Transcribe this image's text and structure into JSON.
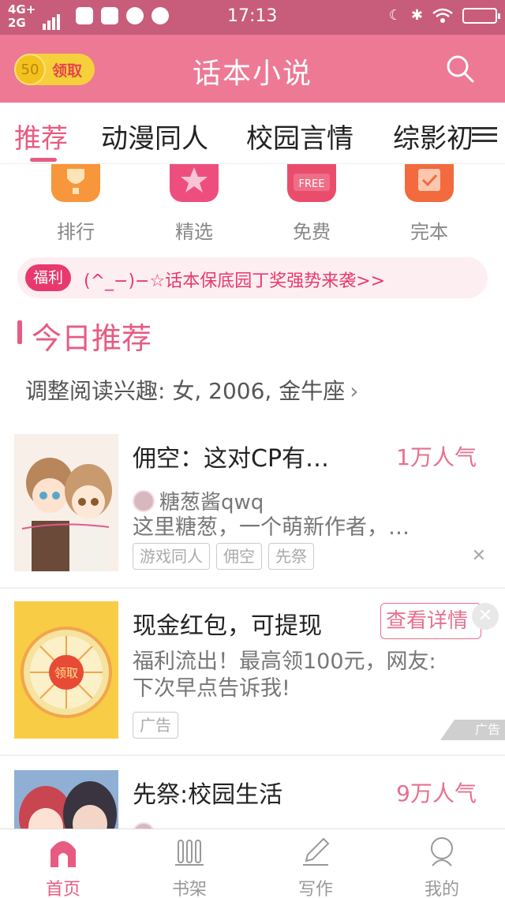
{
  "status_bar": {
    "network_top": "4G+",
    "network_bottom": "2G",
    "time": "17:13"
  },
  "header": {
    "coin_value": "50",
    "coin_label": "领取",
    "title": "话本小说",
    "search_icon": "search-icon",
    "colors": {
      "primary": "#ed7995",
      "accent": "#e75b83"
    }
  },
  "tabs": [
    {
      "label": "推荐",
      "active": true
    },
    {
      "label": "动漫同人"
    },
    {
      "label": "校园言情"
    },
    {
      "label": "综影初"
    }
  ],
  "quick_links": [
    {
      "label": "排行",
      "icon": "trophy-icon"
    },
    {
      "label": "精选",
      "icon": "star-icon"
    },
    {
      "label": "免费",
      "icon": "free-icon",
      "badge": "FREE"
    },
    {
      "label": "完本",
      "icon": "check-icon"
    }
  ],
  "welfare": {
    "tag": "福利",
    "text": "(^_−)−☆话本保底园丁奖强势来袭>>"
  },
  "section": {
    "title": "今日推荐",
    "interest_text": "调整阅读兴趣: 女, 2006, 金牛座"
  },
  "books": [
    {
      "title": "佣空：这对CP有…",
      "popularity": "1万人气",
      "author": "糖葱酱qwq",
      "description": "这里糖葱，一个萌新作者，…",
      "tags": [
        "游戏同人",
        "佣空",
        "先祭"
      ]
    },
    {
      "title": "先祭:校园生活",
      "popularity": "9万人气",
      "author": "",
      "description": ""
    }
  ],
  "ad": {
    "title": "现金红包，可提现",
    "button": "查看详情",
    "description_line1": "福利流出！最高领100元，网友:",
    "description_line2": "下次早点告诉我!",
    "tag": "广告",
    "mark": "广告",
    "wheel_center": "领取"
  },
  "bottom_nav": [
    {
      "label": "首页",
      "icon": "home-icon",
      "active": true
    },
    {
      "label": "书架",
      "icon": "bookshelf-icon"
    },
    {
      "label": "写作",
      "icon": "pencil-icon"
    },
    {
      "label": "我的",
      "icon": "profile-icon"
    }
  ]
}
